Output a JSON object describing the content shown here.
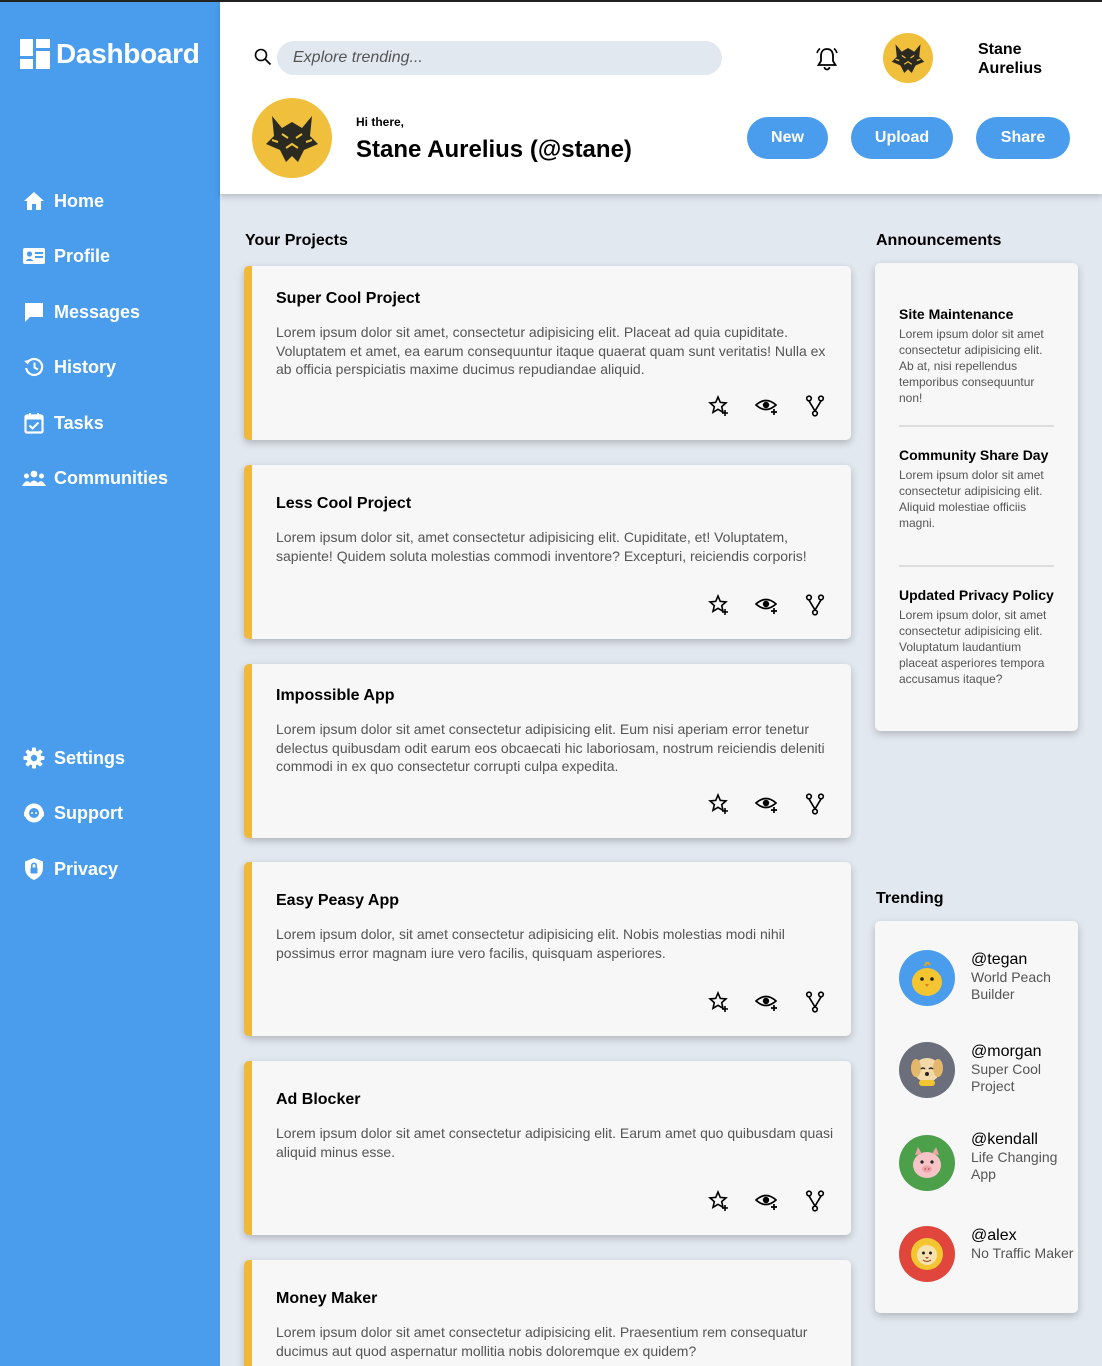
{
  "sidebar": {
    "brand": "Dashboard",
    "nav": [
      {
        "label": "Home",
        "icon": "home-icon"
      },
      {
        "label": "Profile",
        "icon": "profile-card-icon"
      },
      {
        "label": "Messages",
        "icon": "message-icon"
      },
      {
        "label": "History",
        "icon": "history-icon"
      },
      {
        "label": "Tasks",
        "icon": "calendar-check-icon"
      },
      {
        "label": "Communities",
        "icon": "people-icon"
      }
    ],
    "bottom_nav": [
      {
        "label": "Settings",
        "icon": "gear-icon"
      },
      {
        "label": "Support",
        "icon": "support-icon"
      },
      {
        "label": "Privacy",
        "icon": "shield-lock-icon"
      }
    ]
  },
  "header": {
    "search_placeholder": "Explore trending...",
    "username": "Stane Aurelius",
    "greeting": "Hi there,",
    "fullname": "Stane Aurelius (@stane)",
    "buttons": {
      "new": "New",
      "upload": "Upload",
      "share": "Share"
    }
  },
  "projects": {
    "title": "Your Projects",
    "items": [
      {
        "title": "Super Cool Project",
        "desc": "Lorem ipsum dolor sit amet, consectetur adipisicing elit. Placeat ad quia cupiditate. Voluptatem et amet, ea earum consequuntur itaque quaerat quam sunt veritatis! Nulla ex ab officia perspiciatis maxime ducimus repudiandae aliquid."
      },
      {
        "title": "Less Cool Project",
        "desc": "Lorem ipsum dolor sit, amet consectetur adipisicing elit. Cupiditate, et! Voluptatem, sapiente! Quidem soluta molestias commodi inventore? Excepturi, reiciendis corporis!"
      },
      {
        "title": "Impossible App",
        "desc": "Lorem ipsum dolor sit amet consectetur adipisicing elit. Eum nisi aperiam error tenetur delectus quibusdam odit earum eos obcaecati hic laboriosam, nostrum reiciendis deleniti commodi in ex quo consectetur corrupti culpa expedita."
      },
      {
        "title": "Easy Peasy App",
        "desc": "Lorem ipsum dolor, sit amet consectetur adipisicing elit. Nobis molestias modi nihil possimus error magnam iure vero facilis, quisquam asperiores."
      },
      {
        "title": "Ad Blocker",
        "desc": "Lorem ipsum dolor sit amet consectetur adipisicing elit. Earum amet quo quibusdam quasi aliquid minus esse."
      },
      {
        "title": "Money Maker",
        "desc": "Lorem ipsum dolor sit amet consectetur adipisicing elit. Praesentium rem consequatur ducimus aut quod aspernatur mollitia nobis doloremque ex quidem?"
      }
    ]
  },
  "announcements": {
    "title": "Announcements",
    "items": [
      {
        "title": "Site Maintenance",
        "body": "Lorem ipsum dolor sit amet consectetur adipisicing elit. Ab at, nisi repellendus temporibus consequuntur non!"
      },
      {
        "title": "Community Share Day",
        "body": "Lorem ipsum dolor sit amet consectetur adipisicing elit. Aliquid molestiae officiis magni."
      },
      {
        "title": "Updated Privacy Policy",
        "body": "Lorem ipsum dolor, sit amet consectetur adipisicing elit. Voluptatum laudantium placeat asperiores tempora accusamus itaque?"
      }
    ]
  },
  "trending": {
    "title": "Trending",
    "items": [
      {
        "handle": "@tegan",
        "desc": "World Peach Builder",
        "color": "#4a9ded"
      },
      {
        "handle": "@morgan",
        "desc": "Super Cool Project",
        "color": "#6b6f7c"
      },
      {
        "handle": "@kendall",
        "desc": "Life Changing App",
        "color": "#4ca04a"
      },
      {
        "handle": "@alex",
        "desc": "No Traffic Maker",
        "color": "#e0463c"
      }
    ]
  },
  "colors": {
    "accent": "#4a9ded",
    "card_border": "#f0b93a",
    "background": "#e2e8f0"
  }
}
